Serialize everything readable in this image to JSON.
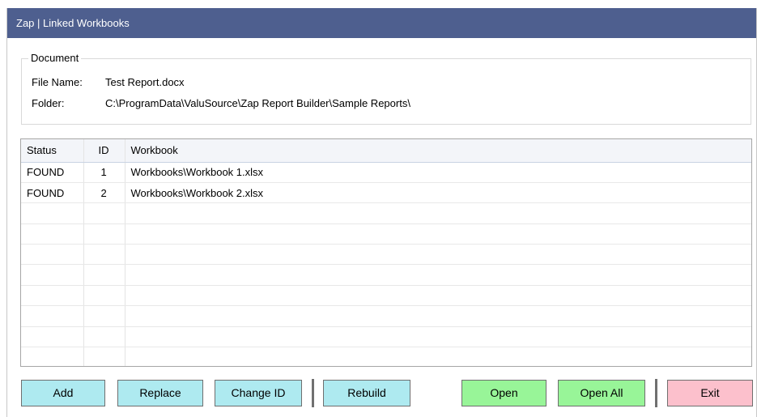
{
  "window": {
    "title": "Zap | Linked Workbooks"
  },
  "document": {
    "legend": "Document",
    "file_name_label": "File Name:",
    "file_name_value": "Test Report.docx",
    "folder_label": "Folder:",
    "folder_value": "C:\\ProgramData\\ValuSource\\Zap Report Builder\\Sample Reports\\"
  },
  "table": {
    "columns": [
      "Status",
      "ID",
      "Workbook"
    ],
    "rows": [
      [
        "FOUND",
        "1",
        "Workbooks\\Workbook 1.xlsx"
      ],
      [
        "FOUND",
        "2",
        "Workbooks\\Workbook 2.xlsx"
      ],
      [
        "",
        "",
        ""
      ],
      [
        "",
        "",
        ""
      ],
      [
        "",
        "",
        ""
      ],
      [
        "",
        "",
        ""
      ],
      [
        "",
        "",
        ""
      ],
      [
        "",
        "",
        ""
      ],
      [
        "",
        "",
        ""
      ],
      [
        "",
        "",
        ""
      ]
    ]
  },
  "buttons": {
    "add": "Add",
    "replace": "Replace",
    "change_id": "Change ID",
    "rebuild": "Rebuild",
    "open": "Open",
    "open_all": "Open All",
    "exit": "Exit"
  },
  "colors": {
    "titlebar": "#4e5f8f",
    "button_cyan": "#aeeaf0",
    "button_green": "#98f598",
    "button_pink": "#fcc0cc"
  }
}
